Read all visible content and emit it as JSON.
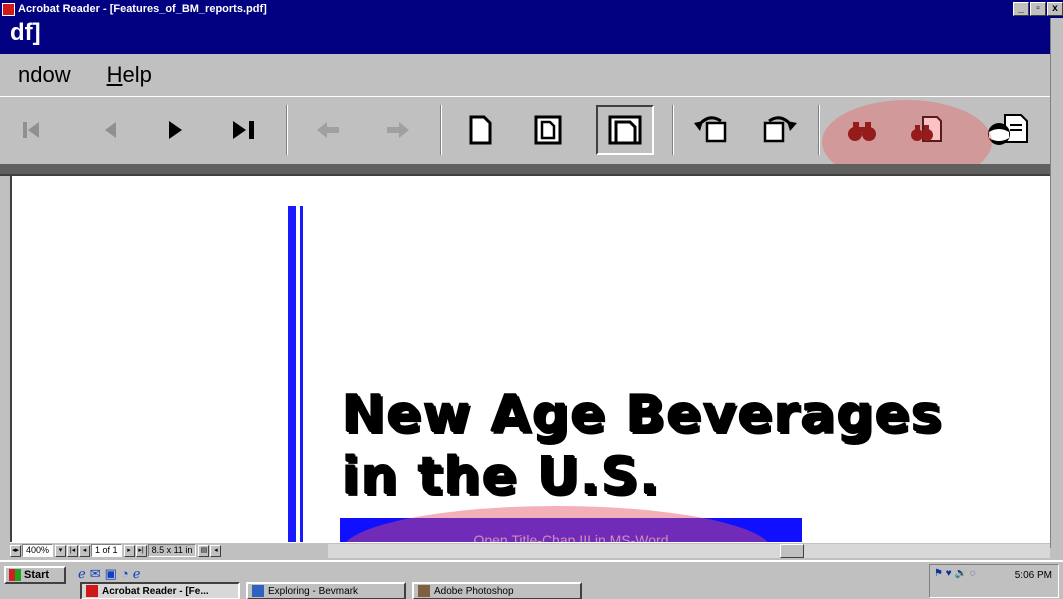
{
  "window": {
    "title": "Acrobat Reader - [Features_of_BM_reports.pdf]",
    "doc_title_fragment": "df]",
    "min_label": "_",
    "max_label": "▫",
    "close_label": "x"
  },
  "menu": {
    "items": [
      "ndow",
      "Help"
    ]
  },
  "toolbar": {
    "first_page": "|◀",
    "prev_page": "◀",
    "next_page": "▶",
    "last_page": "▶|",
    "go_back": "⇦",
    "go_forward": "⇨",
    "actual_size": "🗋",
    "fit_page": "🗏",
    "fit_width": "🗐",
    "rotate_left": "↶",
    "rotate_right": "↷",
    "find": "🔍",
    "find_next": "🔎",
    "icons": [
      "first-page-icon",
      "prev-page-icon",
      "next-page-icon",
      "last-page-icon",
      "go-back-icon",
      "go-forward-icon",
      "actual-size-icon",
      "fit-page-icon",
      "fit-width-icon",
      "rotate-left-icon",
      "rotate-right-icon",
      "binoculars-icon",
      "find-document-icon",
      "page-globe-icon"
    ]
  },
  "document": {
    "headline_line1": "New Age Beverages",
    "headline_line2": "in the U.S.",
    "link_button_label": "Open Title-Chap III in MS-Word"
  },
  "statusbar": {
    "zoom": "400%",
    "page": "1 of 1",
    "page_size": "8.5 x 11 in"
  },
  "taskbar": {
    "start_label": "Start",
    "tasks": [
      {
        "label": "Acrobat Reader - [Fe...",
        "active": true
      },
      {
        "label": "Exploring - Bevmark",
        "active": false
      },
      {
        "label": "Adobe Photoshop",
        "active": false
      }
    ],
    "clock": "5:06 PM"
  },
  "colors": {
    "title_bar": "#000080",
    "chrome": "#c0c0c0",
    "page_rule": "#1a1aff",
    "link_button": "#1010ff",
    "highlight": "#f05050"
  }
}
